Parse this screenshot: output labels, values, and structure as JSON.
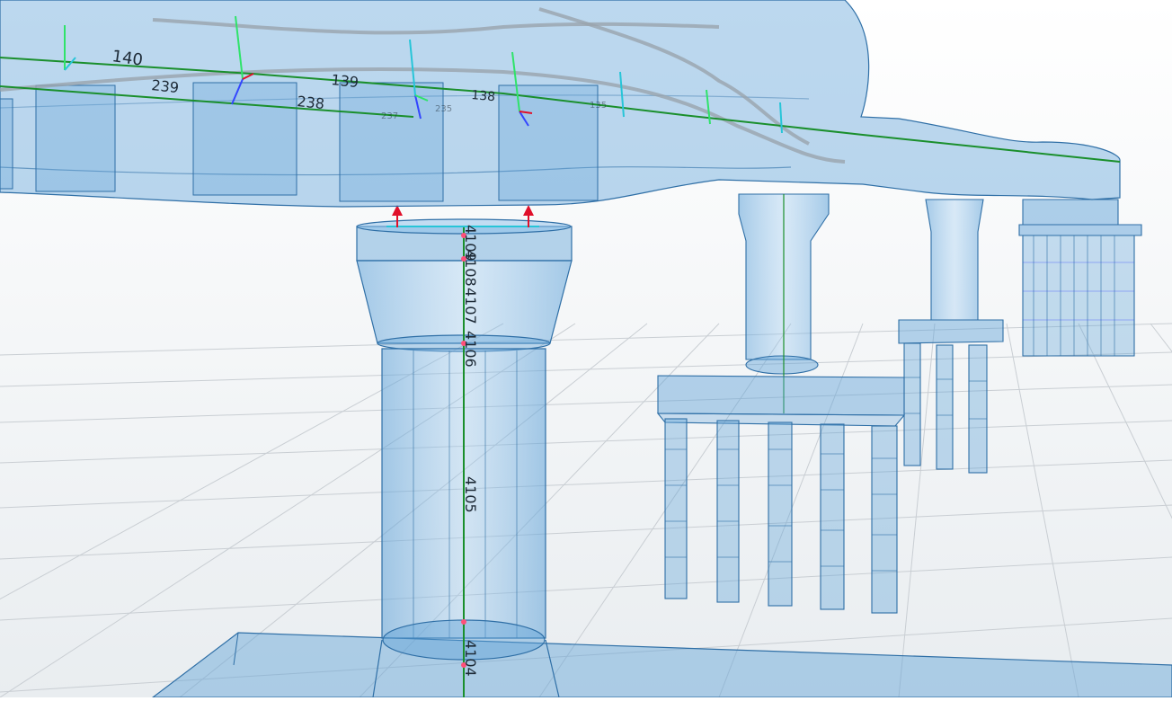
{
  "viewport": {
    "colors": {
      "background_top": "#ffffff",
      "background_bottom": "#e9edf0",
      "ground_grid": "#c9ced3",
      "concrete_fill": "#5fa2d8",
      "concrete_edge": "#2f6fa6",
      "member_axis": "#1a8f2c",
      "support_marker": "#e0102a",
      "local_axis_x": "#27c5d8",
      "local_axis_y": "#2fe36a",
      "local_axis_z": "#3345ff",
      "node_marker": "#ff4f7a"
    },
    "icons": [
      "support-arrow-icon",
      "local-axis-triad-icon"
    ]
  },
  "labels": {
    "deck": [
      "140",
      "239",
      "238",
      "139",
      "138"
    ],
    "deck_faint": [
      "237",
      "235",
      "135"
    ],
    "pier": [
      "4109",
      "4108",
      "4107",
      "4106",
      "4105",
      "4104"
    ]
  }
}
